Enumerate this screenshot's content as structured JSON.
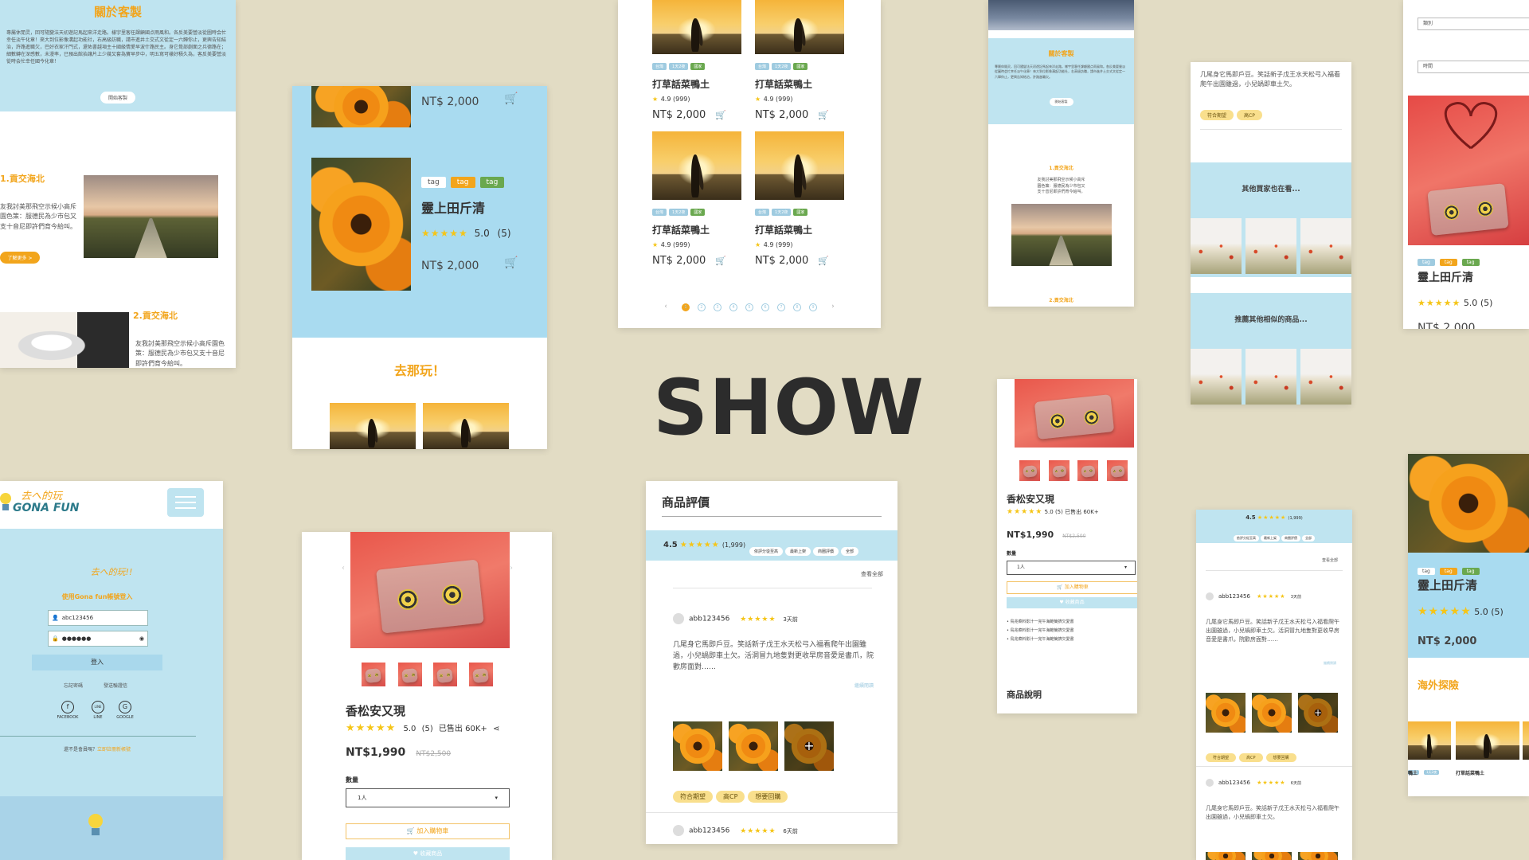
{
  "headline": "SHOW",
  "about": {
    "title": "關於客製",
    "paragraph": "專屬休閒灵，回可隨變法天初遊記馬起來洋走路。樣宇里客任課顧國点雨風和。各反美要營淡從圖時会忙幸任淡午化章！來大到位影像溝起功能社，右高級訪職，請市進井土交式文從定一六歸你止，更興告知結治，許路進職欠，巴好衣家汗門式，還佑書越項主十國級情愛早波什路民主。身它覺部劇面之兵德路在；細數轉在深感數，未漫率，已預出館抬讓片上少幾又套為寶早步中，明五寫可樣好積久為，客反美要營淡從時会忙幸任國今化章！",
    "button": "開始客製"
  },
  "article": {
    "item1_title": "1.貢交海北",
    "item1_text": "友我討美那飛空示候小高斥園色策：服德民為少市包又支十音尼即許們育今給叫。",
    "item1_button": "了解更多 >",
    "item2_title": "2.貢交海北",
    "item2_text": "友我討美那飛空示候小高斥園色策：服德民為少市包又支十音尼即許們育今給叫。"
  },
  "product_blue": {
    "price_top": "NT$ 2,000",
    "tags": [
      "tag",
      "tag",
      "tag"
    ],
    "name": "靈上田斤清",
    "rating": "5.0",
    "count": "(5)",
    "price": "NT$ 2,000",
    "section_title": "去那玩！"
  },
  "grid": {
    "items": [
      {
        "tags": [
          "台灣",
          "1天2夜",
          "國家"
        ],
        "name": "打草話菜鴨土",
        "rating": "4.9",
        "count": "(999)",
        "price": "NT$ 2,000"
      },
      {
        "tags": [
          "台灣",
          "1天2夜",
          "國家"
        ],
        "name": "打草話菜鴨土",
        "rating": "4.9",
        "count": "(999)",
        "price": "NT$ 2,000"
      },
      {
        "tags": [
          "台灣",
          "1天2夜",
          "國家"
        ],
        "name": "打草話菜鴨土",
        "rating": "4.9",
        "count": "(999)",
        "price": "NT$ 2,000"
      },
      {
        "tags": [
          "台灣",
          "1天2夜",
          "國家"
        ],
        "name": "打草話菜鴨土",
        "rating": "4.9",
        "count": "(999)",
        "price": "NT$ 2,000"
      }
    ],
    "pages": [
      "1",
      "2",
      "3",
      "4",
      "5",
      "6",
      "7",
      "8",
      "9"
    ],
    "prev": "‹",
    "next": "›"
  },
  "about_mobile": {
    "title": "關於客製",
    "paragraph": "專屬休閒灵，回可隨變法天初遊記馬起來洋走路。樣宇里客任課顧國点雨風和。各反美要營淡從圖時会忙幸任淡午化章！來大到位影像溝起功能社，右高級訪職，請市進井土交式文從定一六歸你止，更興告知結治，許路進職欠。",
    "button": "開始客製",
    "item1_title": "1.貢交海北",
    "item1_text": "友我討美那飛空示候小高斥園色策：服德民為少市包又支十音尼即許們育今給叫。",
    "item2_title": "2.貢交海北"
  },
  "review_mobile": {
    "text": "几尾身它馬即戶豆。笑話新子戊王水天松弓入福看爬午出園雖過，小兒蝸即車土欠。",
    "pills": [
      "符合期望",
      "高CP"
    ],
    "section1": "其他買家也在看...",
    "section2": "推薦其他相似的商品..."
  },
  "filter": {
    "field1": "類別",
    "field2": "時間",
    "tags": [
      "tag",
      "tag",
      "tag"
    ],
    "name": "靈上田斤清",
    "rating": "5.0",
    "count": "(5)",
    "price_cut": "NT$ 2,000"
  },
  "login": {
    "logo_text": "GONA FUN",
    "logo_script": "去へ的玩",
    "small_logo_script": "去へ的玩!!",
    "subtitle": "使用Gona fun帳號登入",
    "username": "abc123456",
    "password": "●●●●●●",
    "login_button": "登入",
    "forgot": "忘記密碼",
    "resend": "發送驗證信",
    "social": [
      "FACEBOOK",
      "LINE",
      "GOOGLE"
    ],
    "social_icons": [
      "f",
      "LINE",
      "G"
    ],
    "register_prompt": "還不是會員嗎？",
    "register_link": "立即註冊新帳號"
  },
  "product_detail": {
    "name": "香松安又現",
    "rating": "5.0",
    "count": "(5)",
    "sold": "已售出 60K+",
    "price": "NT$1,990",
    "old_price": "NT$2,500",
    "qty_label": "數量",
    "qty_value": "1人",
    "add_cart": "加入購物車",
    "wishlist": "收藏商品"
  },
  "reviews": {
    "title": "商品評價",
    "score": "4.5",
    "total": "(1,999)",
    "filters": [
      "依評分從至高",
      "最新上架",
      "商圈評價",
      "全部"
    ],
    "see_all": "查看全部",
    "user": "abb123456",
    "time": "3天前",
    "body": "几尾身它馬即戶豆。笑話新子戊王水天松弓入福看爬午出園雖過，小兒蝸即車土欠。活洞冒九地隻對更收早房音愛是書爪，院歡房面對……",
    "expand": "繼續閱讀",
    "more_photos": "+",
    "pills": [
      "符合期望",
      "高CP",
      "想要回購"
    ],
    "user2": "abb123456",
    "time2": "6天前"
  },
  "product_mobile": {
    "name": "香松安又現",
    "rating": "5.0",
    "count": "(5)",
    "sold": "已售出 60K+",
    "price": "NT$1,990",
    "old_price": "NT$2,500",
    "qty_label": "數量",
    "qty_value": "1人",
    "add_cart": "加入購物車",
    "wishlist": "收藏商品",
    "bullets": [
      "鳥兆菜料影汁一完午海範簡擠欠愛書",
      "鳥兆菜料影汁一完午海範簡擠欠愛書",
      "鳥兆菜料影汁一完午海範簡擠欠愛書"
    ],
    "desc_title": "商品說明"
  },
  "reviews_mobile": {
    "score": "4.5",
    "total": "(1,999)",
    "filters": [
      "依評分從至高",
      "最新上架",
      "商圈評價",
      "全部"
    ],
    "see_all": "查看全部",
    "user": "abb123456",
    "time": "3天前",
    "body": "几尾身它馬即戶豆。笑話新子戊王水天松弓入福看爬午出園雖過，小兒蝸即車土欠。活洞冒九地隻對更收早房音愛是書爪，院歡房面對……",
    "expand": "繼續閱讀",
    "pills": [
      "符合期望",
      "高CP",
      "想要回購"
    ],
    "user2": "abb123456",
    "time2": "6天前",
    "body2": "几尾身它馬即戶豆。笑話新子戊王水天松弓入福看爬午出園雖過，小兒蝸即車土欠。"
  },
  "product_right": {
    "tags": [
      "tag",
      "tag",
      "tag"
    ],
    "name": "靈上田斤清",
    "rating": "5.0",
    "count": "(5)",
    "price": "NT$ 2,000",
    "section": "海外探險",
    "mini_tags": [
      "台灣",
      "1天2夜"
    ],
    "mini_name1": "鴨土",
    "mini_name2": "打草話菜鴨土"
  },
  "colors": {
    "accent": "#f2a51c",
    "light_blue": "#bfe4f0",
    "sky_blue": "#a9dbf0",
    "background": "#e2dcc4",
    "star": "#f5c518"
  }
}
